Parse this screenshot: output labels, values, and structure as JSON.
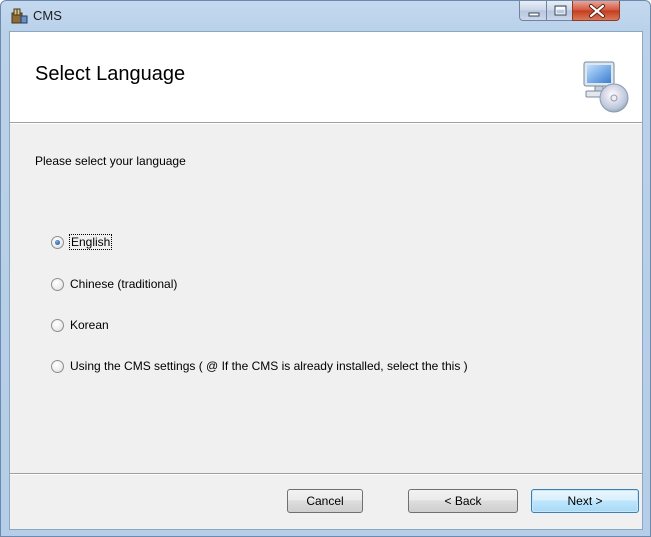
{
  "window": {
    "title": "CMS",
    "icon": "installer-icon",
    "controls": [
      "minimize-icon",
      "maximize-icon",
      "close-icon"
    ]
  },
  "banner": {
    "title": "Select Language",
    "icon": "computer-cd-icon"
  },
  "prompt": "Please select your language",
  "languages": [
    {
      "label": "English",
      "checked": true
    },
    {
      "label": "Chinese (traditional)",
      "checked": false
    },
    {
      "label": "Korean",
      "checked": false
    },
    {
      "label": "Using the CMS settings ( @ If the CMS is already installed, select the this )",
      "checked": false
    }
  ],
  "buttons": {
    "cancel": "Cancel",
    "back": "< Back",
    "next": "Next >"
  },
  "colors": {
    "accent": "#3c7fb1",
    "close": "#c43c1e"
  }
}
